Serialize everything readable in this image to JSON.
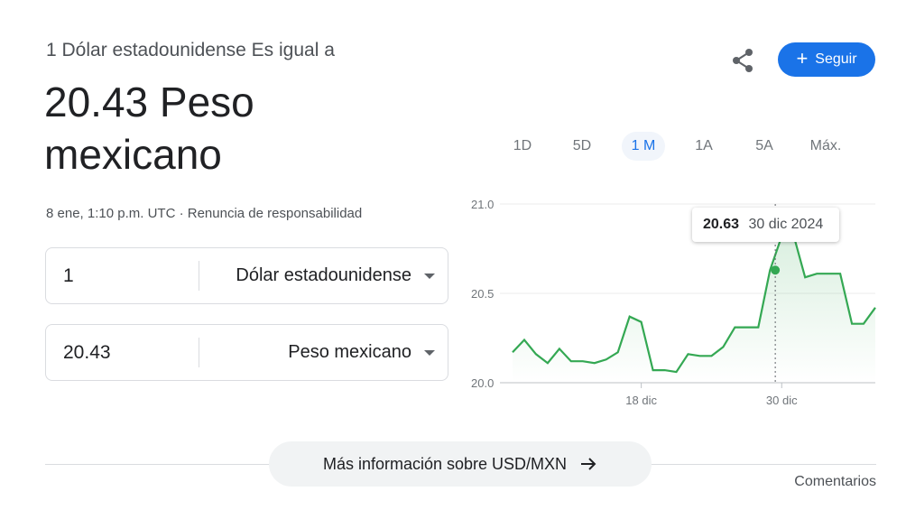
{
  "header": {
    "subtitle": "1 Dólar estadounidense Es igual a",
    "result_line1": "20.43 Peso",
    "result_line2": "mexicano"
  },
  "meta": {
    "timestamp": "8 ene, 1:10 p.m. UTC",
    "separator": "·",
    "disclaimer": "Renuncia de responsabilidad"
  },
  "converter": {
    "from": {
      "value": "1",
      "currency": "Dólar estadounidense"
    },
    "to": {
      "value": "20.43",
      "currency": "Peso mexicano"
    }
  },
  "actions": {
    "share_icon": "share-icon",
    "follow_label": "Seguir",
    "follow_icon": "+"
  },
  "range_tabs": {
    "items": [
      "1D",
      "5D",
      "1 M",
      "1A",
      "5A",
      "Máx."
    ],
    "active": "1 M"
  },
  "tooltip": {
    "value": "20.63",
    "date": "30 dic 2024"
  },
  "more_info": {
    "label": "Más información sobre USD/MXN",
    "icon": "arrow-right-icon"
  },
  "feedback_label": "Comentarios",
  "colors": {
    "line": "#34a853",
    "accent": "#1a73e8"
  },
  "chart_data": {
    "type": "line",
    "yticks": [
      "21.0",
      "20.5",
      "20.0"
    ],
    "ylim": [
      20.0,
      21.0
    ],
    "xticks": [
      "18 dic",
      "30 dic"
    ],
    "xtick_index": [
      11,
      23
    ],
    "highlight_index": 23,
    "series": [
      {
        "values": [
          20.17,
          20.24,
          20.16,
          20.11,
          20.19,
          20.12,
          20.12,
          20.11,
          20.13,
          20.17,
          20.37,
          20.34,
          20.07,
          20.07,
          20.06,
          20.16,
          20.15,
          20.15,
          20.2,
          20.31,
          20.31,
          20.31,
          20.63,
          20.82,
          20.83,
          20.59,
          20.61,
          20.61,
          20.61,
          20.33,
          20.33,
          20.42
        ]
      }
    ]
  }
}
